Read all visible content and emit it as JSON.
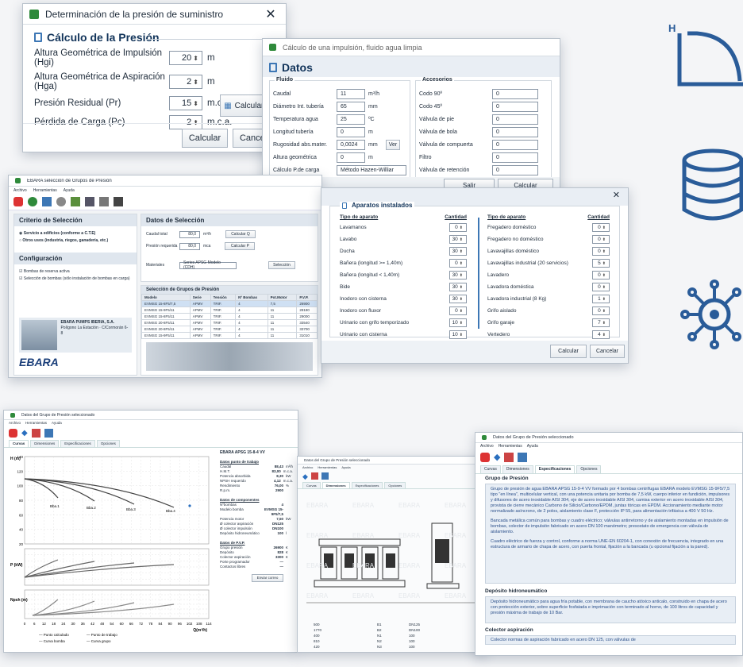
{
  "w1": {
    "title": "Determinación de la presión de suministro",
    "section": "Cálculo de la Presión",
    "rows": [
      {
        "label": "Altura Geométrica de Impulsión (Hgi)",
        "value": "20",
        "unit": "m"
      },
      {
        "label": "Altura Geométrica de Aspiración (Hga)",
        "value": "2",
        "unit": "m"
      },
      {
        "label": "Presión Residual (Pr)",
        "value": "15",
        "unit": "m.c.a."
      },
      {
        "label": "Pérdida de Carga (Pc)",
        "value": "2",
        "unit": "m.c.a."
      }
    ],
    "calc_p_button": "Calcular P",
    "calc_button": "Calcular",
    "cancel_button": "Cancelar"
  },
  "w2": {
    "title": "Cálculo de una impulsión, fluido agua limpia",
    "section": "Datos",
    "fluido_label": "Fluido",
    "accesorios_label": "Accesorios",
    "fluido": [
      {
        "label": "Caudal",
        "value": "11",
        "unit": "m³/h"
      },
      {
        "label": "Diámetro Int. tubería",
        "value": "65",
        "unit": "mm"
      },
      {
        "label": "Temperatura agua",
        "value": "25",
        "unit": "ºC"
      },
      {
        "label": "Longitud tubería",
        "value": "0",
        "unit": "m"
      },
      {
        "label": "Rugosidad abs.mater.",
        "value": "0,0024",
        "unit": "mm"
      },
      {
        "label": "Altura geométrica",
        "value": "0",
        "unit": "m"
      }
    ],
    "ver_button": "Ver",
    "calc_pcarga_label": "Cálculo P.de carga",
    "calc_pcarga_value": "Método Hazen-Williar",
    "accesorios": [
      {
        "label": "Codo 90º",
        "value": "0"
      },
      {
        "label": "Codo 45º",
        "value": "0"
      },
      {
        "label": "Válvula de pie",
        "value": "0"
      },
      {
        "label": "Válvula de bola",
        "value": "0"
      },
      {
        "label": "Válvula de compuerta",
        "value": "0"
      },
      {
        "label": "Filtro",
        "value": "0"
      },
      {
        "label": "Válvula de retención",
        "value": "0"
      }
    ],
    "salir_button": "Salir",
    "calcular_button": "Calcular"
  },
  "w3": {
    "title": "EBARA selección de Grupos de Presión",
    "menu": [
      "Archivo",
      "Herramientas",
      "Ayuda"
    ],
    "criterio_title": "Criterio de Selección",
    "criterio_opts": [
      "Servicio a edificios (conforme a C.T.E)",
      "Otros usos (industria, riegos, ganadería, etc.)"
    ],
    "config_title": "Configuración",
    "config_opts": [
      "Bombas de reserva activa",
      "Selección de bombas (sólo instalación de bombas en carga)"
    ],
    "datos_title": "Datos de Selección",
    "caudal_label": "Caudal total",
    "caudal_value": "80,0",
    "caudal_unit": "m³/h",
    "presion_label": "Presión requerida",
    "presion_value": "80,0",
    "presion_unit": "mca",
    "calc_q": "Calcular Q",
    "calc_p": "Calcular P",
    "materiales_label": "Materiales",
    "materiales_value": "Series APSG Modelo (CDH)",
    "seleccion_button": "Selección",
    "grupo_title": "Selección de Grupos de Presión",
    "table_headers": [
      "Modelo",
      "Serie",
      "Tensión",
      "Nº Bombas",
      "Pot.Motor",
      "P.V.P."
    ],
    "table_rows": [
      [
        "EVMSG 15-8F5/7,5",
        "APMV",
        "TRIF.",
        "4",
        "7,5",
        "26900"
      ],
      [
        "EVMSG 15-9F5/11",
        "APMV",
        "TRIF.",
        "4",
        "11",
        "28180"
      ],
      [
        "EVMSG 15-8F5/11",
        "APMV",
        "TRIF.",
        "4",
        "11",
        "29000"
      ],
      [
        "EVMSG 20-8F5/11",
        "APMV",
        "TRIF.",
        "4",
        "11",
        "33540"
      ],
      [
        "EVMSG 20-8F5/11",
        "APMV",
        "TRIF.",
        "4",
        "11",
        "33700"
      ],
      [
        "EVMSG 15-9F5/11",
        "APMV",
        "TRIF.",
        "4",
        "11",
        "31010"
      ]
    ],
    "company": "EBARA PUMPS IBERIA, S.A.",
    "address": "Polígono La Estación · C/Cormorán 6-8",
    "brand": "EBARA"
  },
  "w4": {
    "section": "Aparatos instalados",
    "col_tipo": "Tipo de aparato",
    "col_cant": "Cantidad",
    "left": [
      {
        "label": "Lavamanos",
        "value": "0"
      },
      {
        "label": "Lavabo",
        "value": "30"
      },
      {
        "label": "Ducha",
        "value": "30"
      },
      {
        "label": "Bañera (longitud >= 1,40m)",
        "value": "0"
      },
      {
        "label": "Bañera (longitud < 1,40m)",
        "value": "30"
      },
      {
        "label": "Bide",
        "value": "30"
      },
      {
        "label": "Inodoro con cisterna",
        "value": "30"
      },
      {
        "label": "Inodoro con fluxor",
        "value": "0"
      },
      {
        "label": "Urinario con grifo temporizado",
        "value": "10"
      },
      {
        "label": "Urinario con cisterna",
        "value": "10"
      }
    ],
    "right": [
      {
        "label": "Fregadero doméstico",
        "value": "0"
      },
      {
        "label": "Fregadero no doméstico",
        "value": "0"
      },
      {
        "label": "Lavavajillas doméstico",
        "value": "0"
      },
      {
        "label": "Lavavajillas industrial (20 servicios)",
        "value": "5"
      },
      {
        "label": "Lavadero",
        "value": "0"
      },
      {
        "label": "Lavadora doméstica",
        "value": "0"
      },
      {
        "label": "Lavadora industrial (8 Kg)",
        "value": "1"
      },
      {
        "label": "Grifo aislado",
        "value": "0"
      },
      {
        "label": "Grifo garaje",
        "value": "7"
      },
      {
        "label": "Vertedero",
        "value": "4"
      }
    ],
    "calcular_button": "Calcular",
    "cancelar_button": "Cancelar"
  },
  "w5": {
    "title": "Datos del Grupo de Presión seleccionado",
    "menu": [
      "Archivo",
      "Herramientas",
      "Ayuda"
    ],
    "tabs": [
      "Curvas",
      "Dimensiones",
      "Especificaciones",
      "Opciones"
    ],
    "model_title": "EBARA APSG 15-8-4 VV",
    "punto_title": "Datos punto de trabajo",
    "punto_rows": [
      [
        "Caudal",
        "88,43",
        "m³/h"
      ],
      [
        "H.M.T.",
        "83,00",
        "m.c.a."
      ],
      [
        "Potencia absorbida",
        "8,30",
        "kW"
      ],
      [
        "NPSH requerido",
        "4,12",
        "m.c.a."
      ],
      [
        "Rendimiento",
        "76,00",
        "%"
      ],
      [
        "R.p.m.",
        "2900",
        ""
      ]
    ],
    "comp_title": "Datos de componentes",
    "comp_rows": [
      [
        "Nºbombas",
        "4",
        ""
      ],
      [
        "Modelo bomba",
        "EVMSG 15-9F5/7,5",
        ""
      ],
      [
        "Potencia motor",
        "7,50",
        "kW"
      ],
      [
        "Ø colector aspiración",
        "DN125",
        ""
      ],
      [
        "Ø colector impulsión",
        "DN100",
        ""
      ],
      [
        "Depósito hidroneumático",
        "100",
        "l"
      ]
    ],
    "pvp_title": "Datos de P.V.P.",
    "pvp_rows": [
      [
        "Grupo presión",
        "26900",
        "€"
      ],
      [
        "Depósito",
        "828",
        "€"
      ],
      [
        "Colector aspiración",
        "3300",
        "€"
      ],
      [
        "Porte programador",
        "—",
        ""
      ],
      [
        "Contactos libres",
        "—",
        ""
      ]
    ],
    "legend": [
      "Punto calculado",
      "Punto de trabajo",
      "Curva bomba",
      "Curva grupo"
    ],
    "curve_labels": [
      "Bba.1",
      "Bba.2",
      "Bba.3",
      "Bba.4"
    ],
    "axis_h": "H (m)",
    "axis_p": "P (kW)",
    "axis_npsh": "Npsh (m)",
    "axis_q": "Q(m³/h)",
    "x_ticks": [
      "0",
      "6",
      "12",
      "18",
      "24",
      "30",
      "36",
      "42",
      "48",
      "54",
      "60",
      "66",
      "72",
      "78",
      "84",
      "90",
      "96",
      "102",
      "108",
      "114"
    ],
    "y_ticks_h": [
      "140",
      "120",
      "100",
      "80",
      "60",
      "40",
      "20"
    ],
    "enviar_button": "Enviar correo"
  },
  "w6": {
    "title": "Datos del Grupo de Presión seleccionado",
    "menu": [
      "Archivo",
      "Herramientas",
      "Ayuda"
    ],
    "tabs": [
      "Curvas",
      "Dimensiones",
      "Especificaciones",
      "Opciones"
    ],
    "watermark": "EBARA",
    "dims": [
      [
        "500",
        "B1",
        "DN125"
      ],
      [
        "1770",
        "B2",
        "DN100"
      ],
      [
        "400",
        "N1",
        "100"
      ],
      [
        "810",
        "N2",
        "100"
      ],
      [
        "420",
        "N3",
        "100"
      ]
    ]
  },
  "w7": {
    "title": "Datos del Grupo de Presión seleccionado",
    "menu": [
      "Archivo",
      "Herramientas",
      "Ayuda"
    ],
    "tabs": [
      "Curvas",
      "Dimensiones",
      "Especificaciones",
      "Opciones"
    ],
    "grupo_title": "Grupo de Presión",
    "grupo_text_1": "Grupo de presión de agua EBARA APSG 15-9-4 VV formado por 4 bombas centrífugas EBARA modelo EVMSG 15-9F5/7,5 tipo \"en línea\", multicelular vertical, con una potencia unitaria por bomba de 7,5 kW, cuerpo inferior en fundición, impulsores y difusores de acero inoxidable AISI 304, eje de acero inoxidable AISI 304, camisa exterior en acero inoxidable AISI 304, provista de cierre mecánico Carbono de Silicio/Carbono/EPDM, juntas tóricas en EPDM. Accionamiento mediante motor normalizado asíncrono, de 2 polos, aislamiento clase F, protección IP 55, para alimentación trifásica a 400 V 50 Hz.",
    "grupo_text_2": "Bancada metálica común para bombas y cuadro eléctrico; válvulas antirretorno y de aislamiento montadas en impulsión de bombas, colector de impulsión fabricado en acero DN 100 manómetro; presostato de emergencia con válvula de aislamiento.",
    "grupo_text_3": "Cuadro eléctrico de fuerza y control, conforme a norma UNE-EN 60204-1, con conexión de frecuencia, integrado en una estructura de armario de chapa de acero, con puerta frontal, fijación a la bancada (u opcional fijación a la pared).",
    "deposito_title": "Depósito hidroneumático",
    "deposito_text": "Depósito hidroneumático para agua fría potable, con membrana de caucho atóxico anticalo, construido en chapa de acero con protección exterior, sobre superficie fosfatada e imprimación con terminado al horno, de 100 litros de capacidad y presión máxima de trabajo de 10 Bar.",
    "colector_title": "Colector aspiración",
    "colector_text": "Colector normas de aspiración fabricado en acero DN 125, con válvulas de"
  },
  "icons": {
    "h_label": "H",
    "accent": "#2a5c99"
  }
}
